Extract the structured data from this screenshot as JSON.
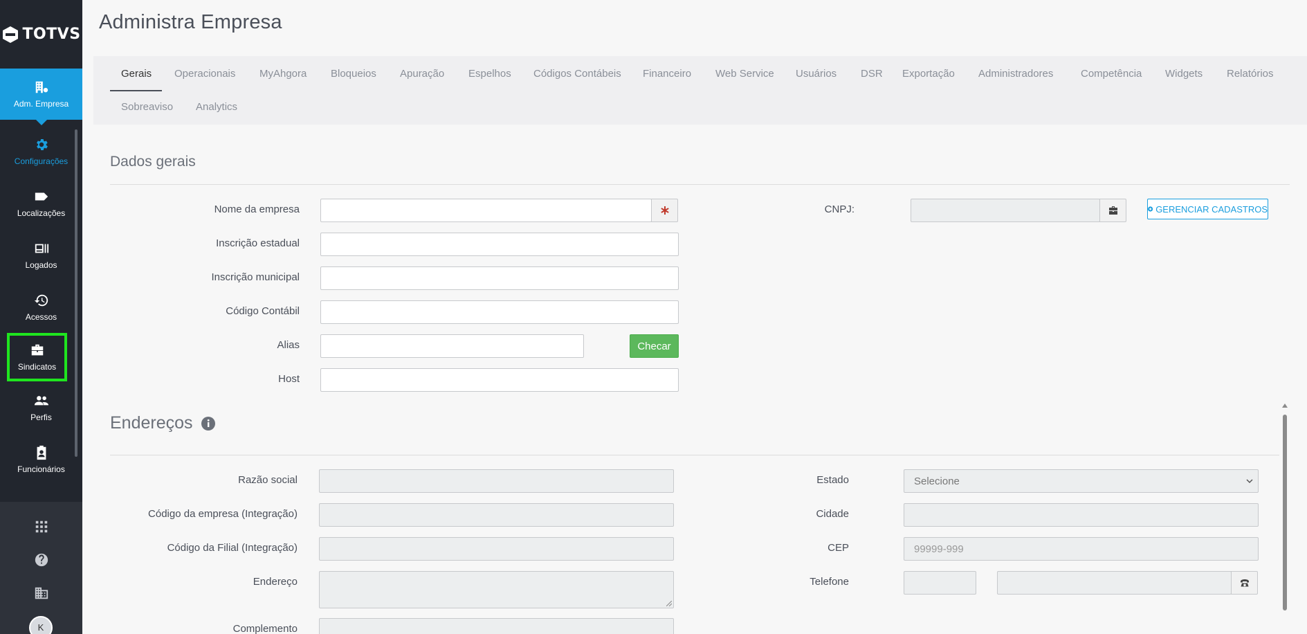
{
  "brand": {
    "logo_text": "TOTVS"
  },
  "sidebar": {
    "items": [
      {
        "label": "Adm. Empresa",
        "icon": "company-admin-icon"
      },
      {
        "label": "Configurações",
        "icon": "gear-icon"
      },
      {
        "label": "Localizações",
        "icon": "tag-icon"
      },
      {
        "label": "Logados",
        "icon": "id-card-icon"
      },
      {
        "label": "Acessos",
        "icon": "history-icon"
      },
      {
        "label": "Sindicatos",
        "icon": "briefcase-icon"
      },
      {
        "label": "Perfis",
        "icon": "users-icon"
      },
      {
        "label": "Funcionários",
        "icon": "badge-icon"
      }
    ],
    "bottom_icons": [
      "apps-grid-icon",
      "help-icon",
      "building-icon"
    ],
    "avatar_initial": "K"
  },
  "header": {
    "title": "Administra Empresa"
  },
  "tabs": [
    "Gerais",
    "Operacionais",
    "MyAhgora",
    "Bloqueios",
    "Apuração",
    "Espelhos",
    "Códigos Contábeis",
    "Financeiro",
    "Web Service",
    "Usuários",
    "DSR",
    "Exportação",
    "Administradores",
    "Competência",
    "Widgets",
    "Relatórios",
    "Sobreaviso",
    "Analytics"
  ],
  "active_tab": "Gerais",
  "dados_gerais": {
    "title": "Dados gerais",
    "nome_empresa_label": "Nome da empresa",
    "inscricao_estadual_label": "Inscrição estadual",
    "inscricao_municipal_label": "Inscrição municipal",
    "codigo_contabil_label": "Código Contábil",
    "alias_label": "Alias",
    "checar_label": "Checar",
    "host_label": "Host",
    "cnpj_label": "CNPJ:",
    "gerenciar_label": "GERENCIAR CADASTROS"
  },
  "enderecos": {
    "title": "Endereços",
    "razao_social_label": "Razão social",
    "codigo_empresa_label": "Código da empresa (Integração)",
    "codigo_filial_label": "Código da Filial (Integração)",
    "endereco_label": "Endereço",
    "complemento_label": "Complemento",
    "estado_label": "Estado",
    "estado_value": "Selecione",
    "cidade_label": "Cidade",
    "cep_label": "CEP",
    "cep_placeholder": "99999-999",
    "telefone_label": "Telefone"
  },
  "colors": {
    "sidebar_bg": "#22262e",
    "accent_blue": "#1a9ede",
    "checar_green": "#5cb85c",
    "highlight_box": "#1fe51f"
  }
}
